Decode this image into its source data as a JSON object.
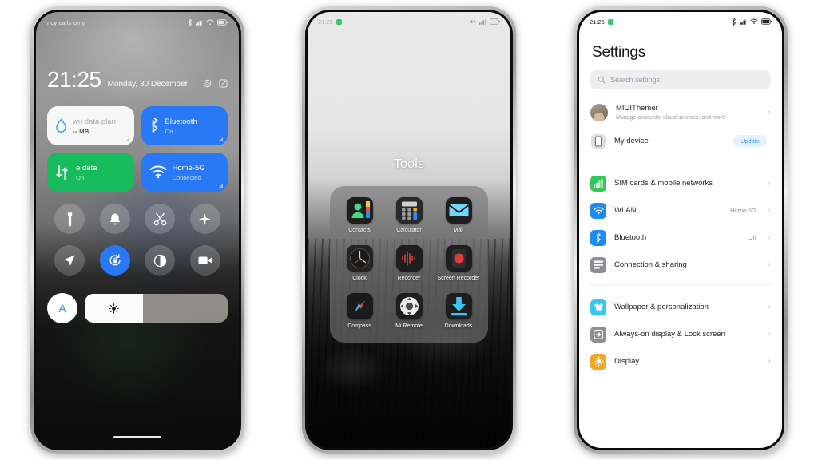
{
  "phone1": {
    "status_bar": {
      "carrier": "ncy calls only",
      "icons": [
        "bluetooth-icon",
        "signal-icon",
        "wifi-icon",
        "battery-icon"
      ]
    },
    "clock": {
      "time": "21:25",
      "date": "Monday, 30 December",
      "icons": [
        "settings-gear-icon",
        "edit-icon"
      ]
    },
    "big_tiles": [
      {
        "name": "data-usage",
        "title": "wn data plan",
        "sub": "-- MB",
        "style": "white",
        "icon": "water-drop-icon"
      },
      {
        "name": "bluetooth",
        "title": "Bluetooth",
        "sub": "On",
        "style": "blue",
        "icon": "bluetooth-icon"
      },
      {
        "name": "mobile-data",
        "title": "e data",
        "sub": "On",
        "style": "green",
        "icon": "data-arrows-icon"
      },
      {
        "name": "wifi",
        "title": "Home-5G",
        "sub": "Connected",
        "style": "blue",
        "icon": "wifi-icon"
      }
    ],
    "toggles": [
      {
        "name": "flashlight",
        "icon": "flashlight-icon",
        "on": false
      },
      {
        "name": "ringer",
        "icon": "bell-icon",
        "on": false
      },
      {
        "name": "screenshot",
        "icon": "scissors-icon",
        "on": false
      },
      {
        "name": "airplane-mode",
        "icon": "airplane-icon",
        "on": false
      },
      {
        "name": "location",
        "icon": "location-arrow-icon",
        "on": false
      },
      {
        "name": "rotation-lock",
        "icon": "rotation-lock-icon",
        "on": true
      },
      {
        "name": "dark-mode",
        "icon": "contrast-icon",
        "on": false
      },
      {
        "name": "screen-recorder",
        "icon": "video-camera-icon",
        "on": false
      }
    ],
    "brightness": {
      "auto_label": "A",
      "icon": "sun-icon",
      "level_percent": 41
    }
  },
  "phone2": {
    "status_bar": {
      "time": "21:25",
      "icons": [
        "green-app-icon",
        "mute-icon",
        "signal-icon",
        "battery-icon"
      ]
    },
    "folder": {
      "title": "Tools",
      "apps": [
        {
          "label": "Contacts",
          "icon": "contacts-icon"
        },
        {
          "label": "Calculator",
          "icon": "calculator-icon"
        },
        {
          "label": "Mail",
          "icon": "mail-icon"
        },
        {
          "label": "Clock",
          "icon": "clock-icon"
        },
        {
          "label": "Recorder",
          "icon": "recorder-waveform-icon"
        },
        {
          "label": "Screen Recorder",
          "icon": "screen-recorder-icon"
        },
        {
          "label": "Compass",
          "icon": "compass-icon"
        },
        {
          "label": "Mi Remote",
          "icon": "remote-dpad-icon"
        },
        {
          "label": "Downloads",
          "icon": "download-arrow-icon"
        }
      ]
    }
  },
  "phone3": {
    "status_bar": {
      "time": "21:25",
      "icons": [
        "green-app-icon",
        "bluetooth-icon",
        "signal-icon",
        "wifi-icon",
        "battery-icon"
      ]
    },
    "title": "Settings",
    "search": {
      "placeholder": "Search settings",
      "icon": "search-icon"
    },
    "account": {
      "name": "MIUIThemer",
      "sub": "Manage accounts, cloud services, and more",
      "icon": "avatar"
    },
    "device": {
      "title": "My device",
      "badge": "Update",
      "icon": "phone-icon"
    },
    "items": [
      {
        "title": "SIM cards & mobile networks",
        "value": "",
        "icon": "signal-bars-icon",
        "color": "#35c759"
      },
      {
        "title": "WLAN",
        "value": "Home-5G",
        "icon": "wifi-icon",
        "color": "#1f8bf5"
      },
      {
        "title": "Bluetooth",
        "value": "On",
        "icon": "bluetooth-icon",
        "color": "#1f8bf5"
      },
      {
        "title": "Connection & sharing",
        "value": "",
        "icon": "list-lines-icon",
        "color": "#8e8e93"
      }
    ],
    "items2": [
      {
        "title": "Wallpaper & personalization",
        "value": "",
        "icon": "shirt-icon",
        "color": "#36c8f0"
      },
      {
        "title": "Always-on display & Lock screen",
        "value": "",
        "icon": "lockscreen-icon",
        "color": "#8e8e93"
      },
      {
        "title": "Display",
        "value": "",
        "icon": "brightness-icon",
        "color": "#f5a623"
      }
    ],
    "chevron": "›"
  }
}
